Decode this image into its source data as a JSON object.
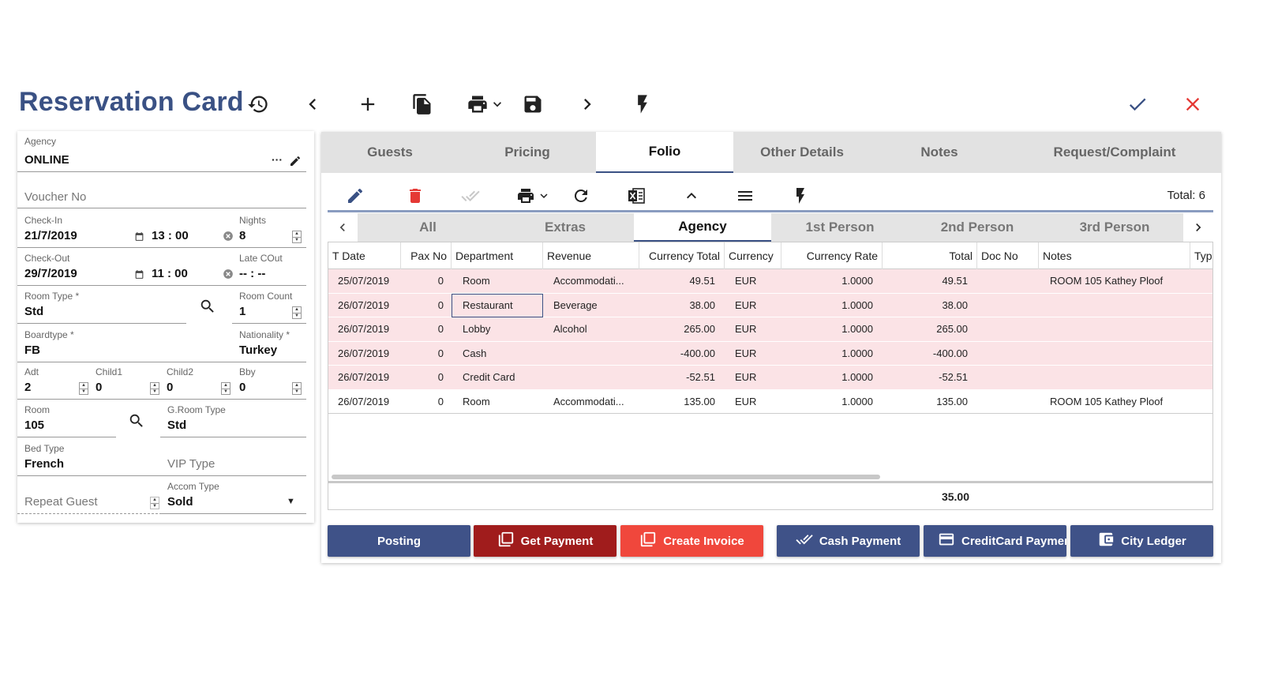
{
  "header": {
    "title": "Reservation Card",
    "icons": [
      "history-icon",
      "chevron-left-icon",
      "plus-icon",
      "copy-icon",
      "print-icon",
      "chevron-down-icon",
      "save-icon",
      "chevron-right-icon",
      "flash-icon",
      "check-icon",
      "close-icon"
    ],
    "colors": {
      "brand": "#3a5184",
      "close": "#e53935"
    }
  },
  "left": {
    "agency": {
      "label": "Agency",
      "value": "ONLINE",
      "more": "···"
    },
    "voucher": {
      "placeholder": "Voucher No"
    },
    "checkin": {
      "label": "Check-In",
      "date": "21/7/2019",
      "time": "13 : 00"
    },
    "nights": {
      "label": "Nights",
      "value": "8"
    },
    "checkout": {
      "label": "Check-Out",
      "date": "29/7/2019",
      "time": "11 : 00"
    },
    "late_cout": {
      "label": "Late COut",
      "value": "-- : --"
    },
    "room_type": {
      "label": "Room Type *",
      "value": "Std"
    },
    "room_count": {
      "label": "Room Count",
      "value": "1"
    },
    "boardtype": {
      "label": "Boardtype *",
      "value": "FB"
    },
    "nationality": {
      "label": "Nationality *",
      "value": "Turkey"
    },
    "adt": {
      "label": "Adt",
      "value": "2"
    },
    "child1": {
      "label": "Child1",
      "value": "0"
    },
    "child2": {
      "label": "Child2",
      "value": "0"
    },
    "bby": {
      "label": "Bby",
      "value": "0"
    },
    "room": {
      "label": "Room",
      "value": "105"
    },
    "groom_type": {
      "label": "G.Room Type",
      "value": "Std"
    },
    "bed_type": {
      "label": "Bed Type",
      "value": "French"
    },
    "vip_type": {
      "placeholder": "VIP Type"
    },
    "repeat_guest": {
      "placeholder": "Repeat Guest"
    },
    "accom_type": {
      "label": "Accom Type",
      "value": "Sold"
    }
  },
  "tabs": [
    "Guests",
    "Pricing",
    "Folio",
    "Other Details",
    "Notes",
    "Request/Complaint"
  ],
  "active_tab": "Folio",
  "toolbar": {
    "total": "Total: 6"
  },
  "subtabs": [
    "All",
    "Extras",
    "Agency",
    "1st Person",
    "2nd Person",
    "3rd Person"
  ],
  "active_subtab": "Agency",
  "table": {
    "headers": [
      "T Date",
      "Pax No",
      "Department",
      "Revenue",
      "Currency Total",
      "Currency",
      "Currency Rate",
      "Total",
      "Doc No",
      "Notes",
      "Typ"
    ],
    "rows": [
      {
        "date": "25/07/2019",
        "pax": "0",
        "dept": "Room",
        "rev": "Accommodati...",
        "ctotal": "49.51",
        "cur": "EUR",
        "rate": "1.0000",
        "total": "49.51",
        "doc": "",
        "notes": "ROOM 105 Kathey Ploof"
      },
      {
        "date": "26/07/2019",
        "pax": "0",
        "dept": "Restaurant",
        "rev": "Beverage",
        "ctotal": "38.00",
        "cur": "EUR",
        "rate": "1.0000",
        "total": "38.00",
        "doc": "",
        "notes": ""
      },
      {
        "date": "26/07/2019",
        "pax": "0",
        "dept": "Lobby",
        "rev": "Alcohol",
        "ctotal": "265.00",
        "cur": "EUR",
        "rate": "1.0000",
        "total": "265.00",
        "doc": "",
        "notes": ""
      },
      {
        "date": "26/07/2019",
        "pax": "0",
        "dept": "Cash",
        "rev": "",
        "ctotal": "-400.00",
        "cur": "EUR",
        "rate": "1.0000",
        "total": "-400.00",
        "doc": "",
        "notes": ""
      },
      {
        "date": "26/07/2019",
        "pax": "0",
        "dept": "Credit Card",
        "rev": "",
        "ctotal": "-52.51",
        "cur": "EUR",
        "rate": "1.0000",
        "total": "-52.51",
        "doc": "",
        "notes": ""
      },
      {
        "date": "26/07/2019",
        "pax": "0",
        "dept": "Room",
        "rev": "Accommodati...",
        "ctotal": "135.00",
        "cur": "EUR",
        "rate": "1.0000",
        "total": "135.00",
        "doc": "",
        "notes": "ROOM 105 Kathey Ploof"
      }
    ],
    "sum_total": "35.00"
  },
  "buttons": {
    "posting": "Posting",
    "get_payment": "Get Payment",
    "create_invoice": "Create Invoice",
    "cash_payment": "Cash Payment",
    "creditcard_payment": "CreditCard Payment",
    "city_ledger": "City Ledger",
    "colors": {
      "navy": "#3f5288",
      "darkred": "#a01c1c",
      "red": "#f0473c"
    }
  }
}
